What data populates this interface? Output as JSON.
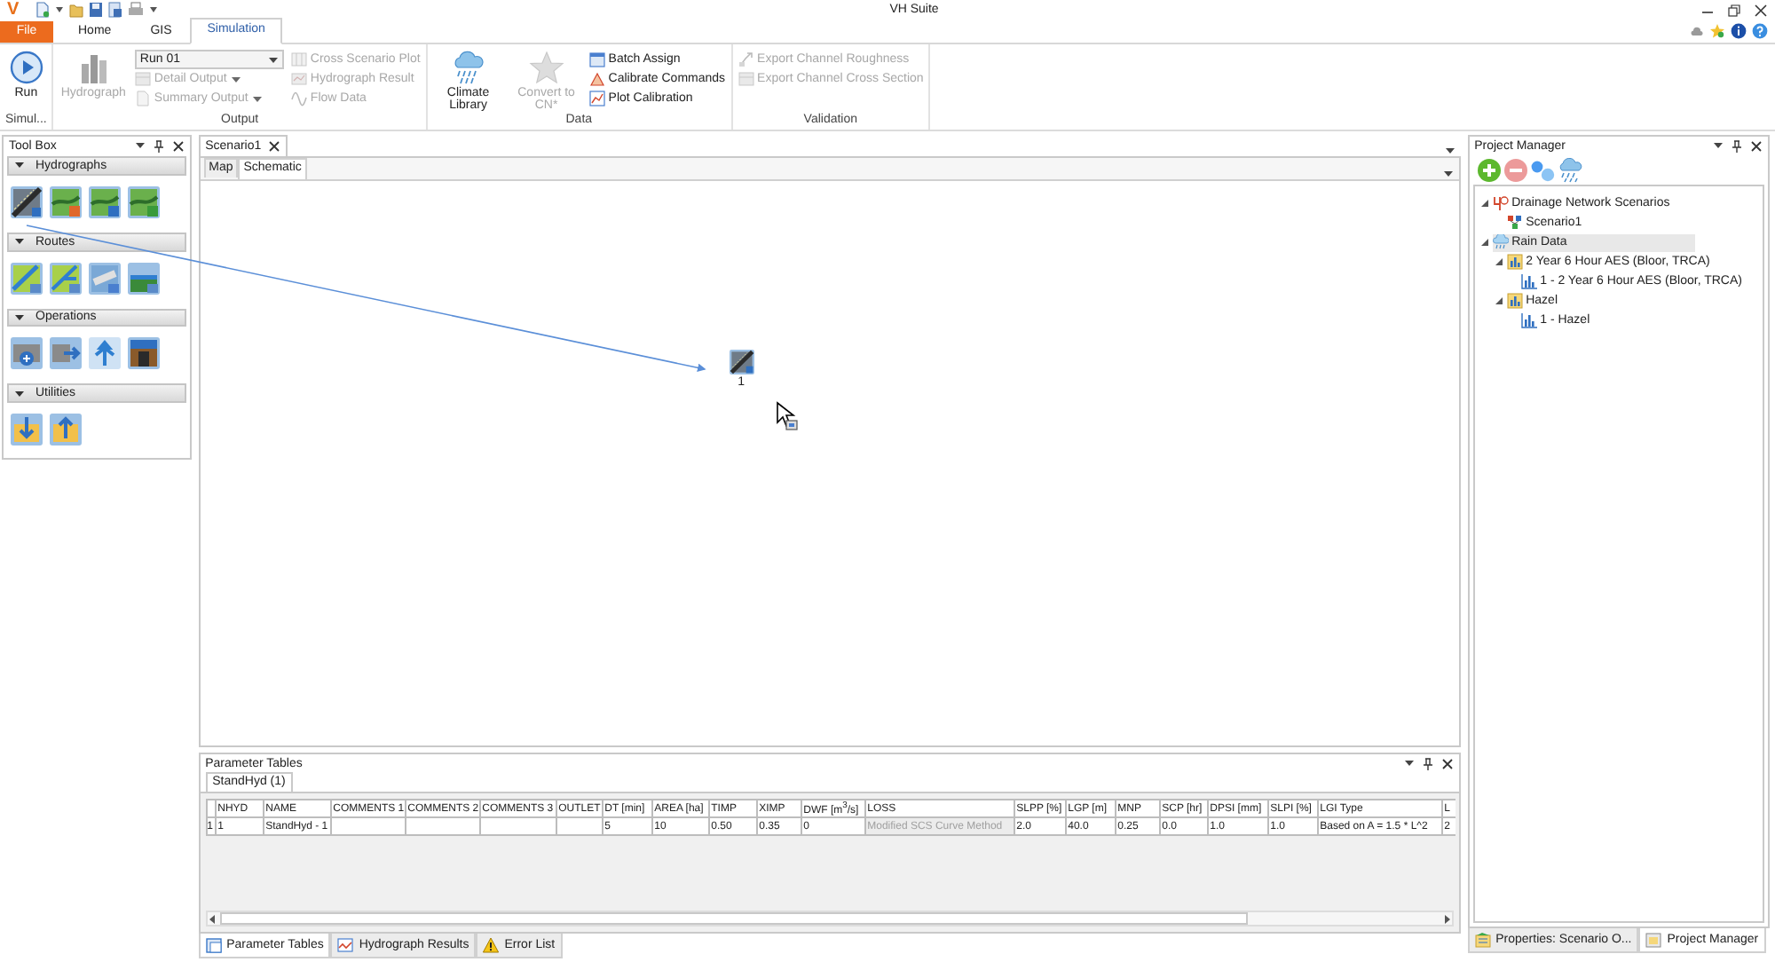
{
  "window": {
    "logo": "V",
    "title": "VH Suite"
  },
  "ribbon": {
    "tabs": [
      {
        "label": "File",
        "kind": "file",
        "selected": false
      },
      {
        "label": "Home",
        "kind": "tab",
        "selected": false
      },
      {
        "label": "GIS",
        "kind": "tab",
        "selected": false
      },
      {
        "label": "Simulation",
        "kind": "tab",
        "selected": true
      }
    ],
    "groups": [
      {
        "label": "Simul...",
        "items": [
          {
            "kind": "large",
            "label": "Run",
            "disabled": false
          }
        ]
      },
      {
        "label": "Output",
        "items": [
          {
            "kind": "large",
            "label": "Hydrograph",
            "disabled": true
          },
          {
            "kind": "combo",
            "value": "Run 01"
          },
          {
            "kind": "small",
            "label": "Detail Output",
            "menu": true,
            "disabled": true
          },
          {
            "kind": "small",
            "label": "Summary Output",
            "menu": true,
            "disabled": true
          },
          {
            "kind": "small",
            "label": "Cross Scenario Plot",
            "menu": false,
            "disabled": true
          },
          {
            "kind": "small",
            "label": "Hydrograph Result",
            "menu": false,
            "disabled": true
          },
          {
            "kind": "small",
            "label": "Flow Data",
            "menu": false,
            "disabled": true
          }
        ]
      },
      {
        "label": "Data",
        "items": [
          {
            "kind": "large",
            "label": "Climate Library",
            "disabled": false
          },
          {
            "kind": "large",
            "label": "Convert to CN*",
            "disabled": true
          },
          {
            "kind": "small",
            "label": "Batch Assign",
            "menu": false,
            "disabled": false
          },
          {
            "kind": "small",
            "label": "Calibrate Commands",
            "menu": false,
            "disabled": false
          },
          {
            "kind": "small",
            "label": "Plot Calibration",
            "menu": false,
            "disabled": false
          }
        ]
      },
      {
        "label": "Validation",
        "items": [
          {
            "kind": "small",
            "label": "Export Channel Roughness",
            "menu": false,
            "disabled": true
          },
          {
            "kind": "small",
            "label": "Export Channel Cross Section",
            "menu": false,
            "disabled": true
          }
        ]
      }
    ]
  },
  "toolbox": {
    "title": "Tool Box",
    "sections": [
      {
        "title": "Hydrographs",
        "expanded": true,
        "tools": [
          {
            "kind": "slope"
          },
          {
            "kind": "land-red"
          },
          {
            "kind": "land-blue"
          },
          {
            "kind": "land-check"
          }
        ]
      },
      {
        "title": "Routes",
        "expanded": true,
        "tools": [
          {
            "kind": "river"
          },
          {
            "kind": "river-fork"
          },
          {
            "kind": "pipe"
          },
          {
            "kind": "channel"
          }
        ]
      },
      {
        "title": "Operations",
        "expanded": true,
        "tools": [
          {
            "kind": "add"
          },
          {
            "kind": "divert"
          },
          {
            "kind": "split"
          },
          {
            "kind": "reservoir"
          }
        ]
      },
      {
        "title": "Utilities",
        "expanded": true,
        "tools": [
          {
            "kind": "import"
          },
          {
            "kind": "export"
          }
        ]
      }
    ]
  },
  "document": {
    "tabs": [
      {
        "label": "Scenario1",
        "selected": true
      }
    ],
    "views": [
      {
        "label": "Map",
        "selected": false
      },
      {
        "label": "Schematic",
        "selected": true
      }
    ],
    "nodes": [
      {
        "label": "1",
        "kind": "slope"
      }
    ]
  },
  "parameter_tables": {
    "title": "Parameter Tables",
    "tabs": [
      {
        "label": "StandHyd (1)",
        "selected": true
      }
    ],
    "columns": [
      "NHYD",
      "NAME",
      "COMMENTS 1",
      "COMMENTS 2",
      "COMMENTS 3",
      "OUTLET",
      "DT [min]",
      "AREA [ha]",
      "TIMP",
      "XIMP",
      "DWF [m$^{3}$/s]",
      "LOSS",
      "SLPP [%]",
      "LGP [m]",
      "MNP",
      "SCP [hr]",
      "DPSI [mm]",
      "SLPI [%]",
      "LGI Type",
      "L"
    ],
    "rows": [
      {
        "header": "1",
        "cells": [
          {
            "value": "1",
            "disabled": false
          },
          {
            "value": "StandHyd - 1",
            "disabled": false
          },
          {
            "disabled": false
          },
          {
            "disabled": false
          },
          {
            "disabled": false
          },
          {
            "disabled": false
          },
          {
            "value": "5",
            "disabled": false
          },
          {
            "value": "10",
            "disabled": false
          },
          {
            "value": "0.50",
            "disabled": false
          },
          {
            "value": "0.35",
            "disabled": false
          },
          {
            "value": "0",
            "disabled": false
          },
          {
            "value": "Modified SCS Curve Method",
            "disabled": true
          },
          {
            "value": "2.0",
            "disabled": false
          },
          {
            "value": "40.0",
            "disabled": false
          },
          {
            "value": "0.25",
            "disabled": false
          },
          {
            "value": "0.0",
            "disabled": false
          },
          {
            "value": "1.0",
            "disabled": false
          },
          {
            "value": "1.0",
            "disabled": false
          },
          {
            "value": "Based on A = 1.5 * L^2",
            "disabled": false
          },
          {
            "value": "2",
            "disabled": false
          }
        ]
      }
    ]
  },
  "bottom_tabs": [
    {
      "label": "Parameter Tables",
      "selected": true
    },
    {
      "label": "Hydrograph Results",
      "selected": false
    },
    {
      "label": "Error List",
      "selected": false
    }
  ],
  "project_manager": {
    "title": "Project Manager",
    "tree": [
      {
        "label": "Drainage Network Scenarios",
        "kind": "scenarios",
        "expanded": true,
        "selected": false,
        "children": [
          {
            "label": "Scenario1",
            "kind": "scenario",
            "selected": false
          }
        ]
      },
      {
        "label": "Rain Data",
        "kind": "rain",
        "expanded": true,
        "selected": true,
        "children": [
          {
            "label": "2 Year 6 Hour AES (Bloor, TRCA)",
            "kind": "storm",
            "expanded": true,
            "selected": false,
            "children": [
              {
                "label": "1 - 2 Year 6 Hour AES (Bloor, TRCA)",
                "kind": "series",
                "selected": false
              }
            ]
          },
          {
            "label": "Hazel",
            "kind": "storm",
            "expanded": true,
            "selected": false,
            "children": [
              {
                "label": "1 - Hazel",
                "kind": "series",
                "selected": false
              }
            ]
          }
        ]
      }
    ]
  },
  "right_tabs": [
    {
      "label": "Properties: Scenario O...",
      "selected": false
    },
    {
      "label": "Project Manager",
      "selected": true
    }
  ]
}
